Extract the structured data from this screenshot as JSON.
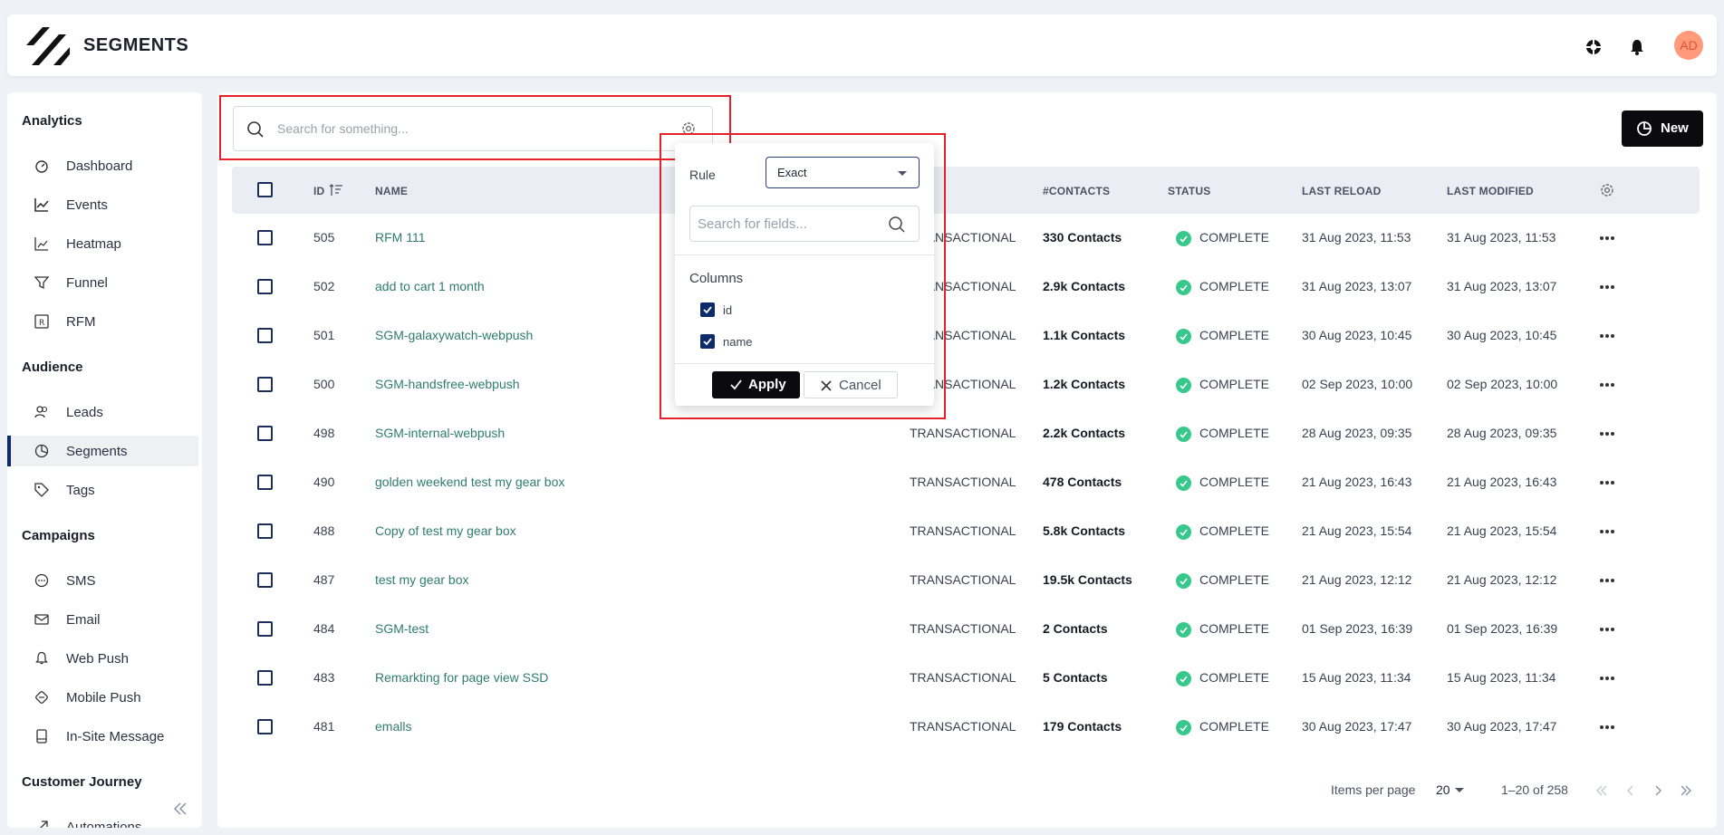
{
  "header": {
    "title": "SEGMENTS",
    "avatar_initials": "AD"
  },
  "sidebar": {
    "sections": [
      {
        "label": "Analytics"
      },
      {
        "label": "Audience"
      },
      {
        "label": "Campaigns"
      },
      {
        "label": "Customer Journey"
      }
    ],
    "items": [
      {
        "label": "Dashboard",
        "icon": "dashboard-icon"
      },
      {
        "label": "Events",
        "icon": "line-chart-icon"
      },
      {
        "label": "Heatmap",
        "icon": "heatmap-icon"
      },
      {
        "label": "Funnel",
        "icon": "funnel-icon"
      },
      {
        "label": "RFM",
        "icon": "rfm-icon"
      },
      {
        "label": "Leads",
        "icon": "users-icon"
      },
      {
        "label": "Segments",
        "icon": "pie-chart-icon",
        "active": true
      },
      {
        "label": "Tags",
        "icon": "tag-icon"
      },
      {
        "label": "SMS",
        "icon": "sms-icon"
      },
      {
        "label": "Email",
        "icon": "mail-icon"
      },
      {
        "label": "Web Push",
        "icon": "bell-icon"
      },
      {
        "label": "Mobile Push",
        "icon": "mobile-push-icon"
      },
      {
        "label": "In-Site Message",
        "icon": "in-site-icon"
      },
      {
        "label": "Automations",
        "icon": "automations-icon"
      }
    ]
  },
  "toolbar": {
    "search_placeholder": "Search for something...",
    "new_label": "New"
  },
  "table": {
    "headers": {
      "id": "ID",
      "name": "NAME",
      "contacts": "#CONTACTS",
      "status": "STATUS",
      "last_reload": "LAST RELOAD",
      "last_modified": "LAST MODIFIED"
    },
    "rows": [
      {
        "id": "505",
        "name": "RFM 111",
        "type": "TRANSACTIONAL",
        "contacts": "330 Contacts",
        "status": "COMPLETE",
        "last_reload": "31 Aug 2023, 11:53",
        "last_modified": "31 Aug 2023, 11:53"
      },
      {
        "id": "502",
        "name": "add to cart 1 month",
        "type": "TRANSACTIONAL",
        "contacts": "2.9k Contacts",
        "status": "COMPLETE",
        "last_reload": "31 Aug 2023, 13:07",
        "last_modified": "31 Aug 2023, 13:07"
      },
      {
        "id": "501",
        "name": "SGM-galaxywatch-webpush",
        "type": "TRANSACTIONAL",
        "contacts": "1.1k Contacts",
        "status": "COMPLETE",
        "last_reload": "30 Aug 2023, 10:45",
        "last_modified": "30 Aug 2023, 10:45"
      },
      {
        "id": "500",
        "name": "SGM-handsfree-webpush",
        "type": "TRANSACTIONAL",
        "contacts": "1.2k Contacts",
        "status": "COMPLETE",
        "last_reload": "02 Sep 2023, 10:00",
        "last_modified": "02 Sep 2023, 10:00"
      },
      {
        "id": "498",
        "name": "SGM-internal-webpush",
        "type": "TRANSACTIONAL",
        "contacts": "2.2k Contacts",
        "status": "COMPLETE",
        "last_reload": "28 Aug 2023, 09:35",
        "last_modified": "28 Aug 2023, 09:35"
      },
      {
        "id": "490",
        "name": "golden weekend test my gear box",
        "type": "TRANSACTIONAL",
        "contacts": "478 Contacts",
        "status": "COMPLETE",
        "last_reload": "21 Aug 2023, 16:43",
        "last_modified": "21 Aug 2023, 16:43"
      },
      {
        "id": "488",
        "name": "Copy of test my gear box",
        "type": "TRANSACTIONAL",
        "contacts": "5.8k Contacts",
        "status": "COMPLETE",
        "last_reload": "21 Aug 2023, 15:54",
        "last_modified": "21 Aug 2023, 15:54"
      },
      {
        "id": "487",
        "name": "test my gear box",
        "type": "TRANSACTIONAL",
        "contacts": "19.5k Contacts",
        "status": "COMPLETE",
        "last_reload": "21 Aug 2023, 12:12",
        "last_modified": "21 Aug 2023, 12:12"
      },
      {
        "id": "484",
        "name": "SGM-test",
        "type": "TRANSACTIONAL",
        "contacts": "2 Contacts",
        "status": "COMPLETE",
        "last_reload": "01 Sep 2023, 16:39",
        "last_modified": "01 Sep 2023, 16:39"
      },
      {
        "id": "483",
        "name": "Remarkting for page view SSD",
        "type": "TRANSACTIONAL",
        "contacts": "5 Contacts",
        "status": "COMPLETE",
        "last_reload": "15 Aug 2023, 11:34",
        "last_modified": "15 Aug 2023, 11:34"
      },
      {
        "id": "481",
        "name": "emalls",
        "type": "TRANSACTIONAL",
        "contacts": "179 Contacts",
        "status": "COMPLETE",
        "last_reload": "30 Aug 2023, 17:47",
        "last_modified": "30 Aug 2023, 17:47"
      }
    ]
  },
  "pagination": {
    "items_per_page_label": "Items per page",
    "items_per_page_value": "20",
    "range": "1–20 of 258"
  },
  "popup": {
    "rule_label": "Rule",
    "rule_value": "Exact",
    "field_search_placeholder": "Search for fields...",
    "columns_label": "Columns",
    "columns": [
      {
        "label": "id",
        "checked": true
      },
      {
        "label": "name",
        "checked": true
      }
    ],
    "apply_label": "Apply",
    "cancel_label": "Cancel"
  },
  "colors": {
    "accent": "#0d2a6b",
    "link": "#2e7d6f",
    "status_complete": "#36c98b",
    "highlight": "#e6212a"
  }
}
